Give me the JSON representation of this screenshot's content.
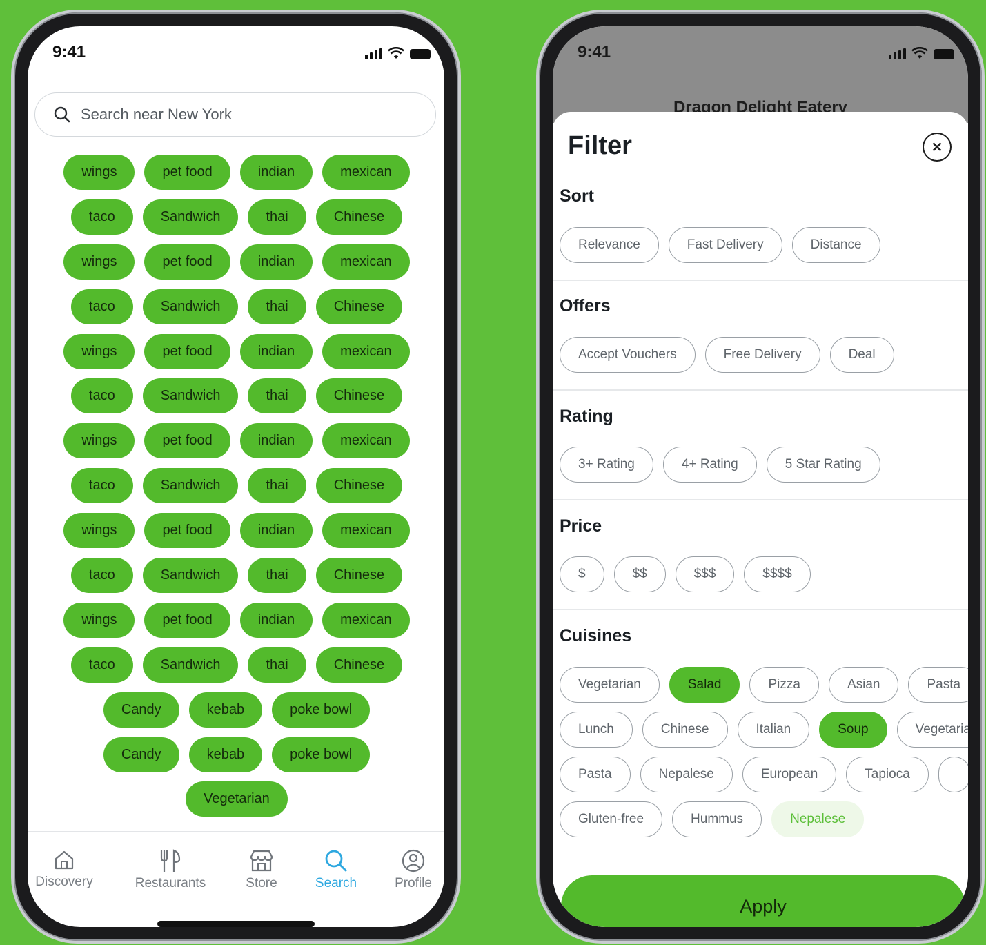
{
  "colors": {
    "background": "#5fbf3a",
    "accent": "#53ba2c",
    "active_tab": "#2ea8e0"
  },
  "left_phone": {
    "status_time": "9:41",
    "search": {
      "placeholder": "Search near New York"
    },
    "tag_rows": [
      [
        "wings",
        "pet food",
        "indian",
        "mexican"
      ],
      [
        "taco",
        "Sandwich",
        "thai",
        "Chinese"
      ],
      [
        "wings",
        "pet food",
        "indian",
        "mexican"
      ],
      [
        "taco",
        "Sandwich",
        "thai",
        "Chinese"
      ],
      [
        "wings",
        "pet food",
        "indian",
        "mexican"
      ],
      [
        "taco",
        "Sandwich",
        "thai",
        "Chinese"
      ],
      [
        "wings",
        "pet food",
        "indian",
        "mexican"
      ],
      [
        "taco",
        "Sandwich",
        "thai",
        "Chinese"
      ],
      [
        "wings",
        "pet food",
        "indian",
        "mexican"
      ],
      [
        "taco",
        "Sandwich",
        "thai",
        "Chinese"
      ],
      [
        "wings",
        "pet food",
        "indian",
        "mexican"
      ],
      [
        "taco",
        "Sandwich",
        "thai",
        "Chinese"
      ],
      [
        "Candy",
        "kebab",
        "poke bowl"
      ],
      [
        "Candy",
        "kebab",
        "poke bowl"
      ],
      [
        "Vegetarian"
      ]
    ],
    "tabs": [
      {
        "label": "Discovery",
        "icon": "home-icon",
        "active": false
      },
      {
        "label": "Restaurants",
        "icon": "fork-knife-icon",
        "active": false
      },
      {
        "label": "Store",
        "icon": "store-icon",
        "active": false
      },
      {
        "label": "Search",
        "icon": "search-icon",
        "active": true
      },
      {
        "label": "Profile",
        "icon": "profile-icon",
        "active": false
      }
    ]
  },
  "right_phone": {
    "status_time": "9:41",
    "restaurant_name": "Dragon Delight Eatery",
    "filter": {
      "title": "Filter",
      "close_icon": "close-icon",
      "sort": {
        "heading": "Sort",
        "options": [
          "Relevance",
          "Fast Delivery",
          "Distance"
        ]
      },
      "offers": {
        "heading": "Offers",
        "options": [
          "Accept Vouchers",
          "Free Delivery",
          "Deal"
        ]
      },
      "rating": {
        "heading": "Rating",
        "options": [
          "3+ Rating",
          "4+ Rating",
          "5 Star Rating"
        ]
      },
      "price": {
        "heading": "Price",
        "options": [
          "$",
          "$$",
          "$$$",
          "$$$$"
        ]
      },
      "cuisines": {
        "heading": "Cuisines",
        "rows": [
          [
            {
              "label": "Vegetarian",
              "state": "off"
            },
            {
              "label": "Salad",
              "state": "on"
            },
            {
              "label": "Pizza",
              "state": "off"
            },
            {
              "label": "Asian",
              "state": "off"
            },
            {
              "label": "Pasta",
              "state": "off"
            }
          ],
          [
            {
              "label": "Lunch",
              "state": "off"
            },
            {
              "label": "Chinese",
              "state": "off"
            },
            {
              "label": "Italian",
              "state": "off"
            },
            {
              "label": "Soup",
              "state": "on"
            },
            {
              "label": "Vegetarian",
              "state": "off"
            }
          ],
          [
            {
              "label": "Pasta",
              "state": "off"
            },
            {
              "label": "Nepalese",
              "state": "off"
            },
            {
              "label": "European",
              "state": "off"
            },
            {
              "label": "Tapioca",
              "state": "off"
            },
            {
              "label": "",
              "state": "off"
            }
          ],
          [
            {
              "label": "Gluten-free",
              "state": "off"
            },
            {
              "label": "Hummus",
              "state": "off"
            },
            {
              "label": "Nepalese",
              "state": "soft"
            }
          ]
        ]
      },
      "apply_label": "Apply"
    }
  }
}
